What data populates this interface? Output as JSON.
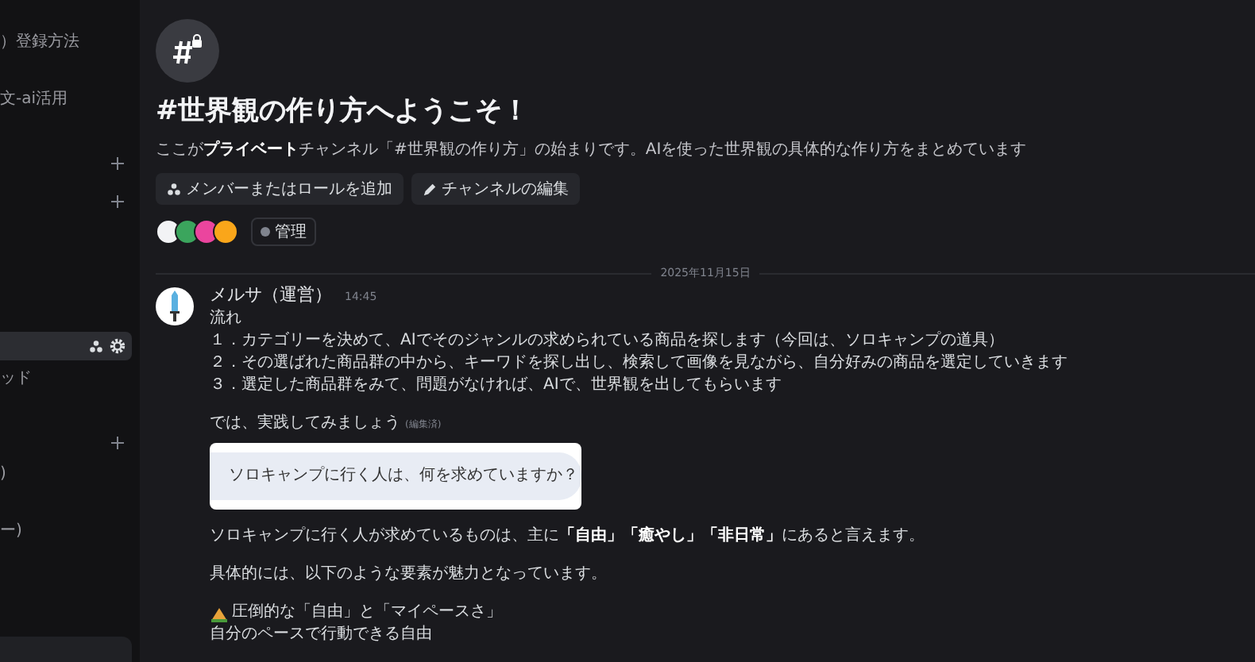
{
  "sidebar": {
    "items": [
      {
        "kind": "text",
        "label": "）登録方法",
        "selected": false
      },
      {
        "kind": "text",
        "label": "文-ai活用",
        "selected": false
      },
      {
        "kind": "add"
      },
      {
        "kind": "add"
      },
      {
        "kind": "channel",
        "selected": true
      },
      {
        "kind": "text",
        "label": "ッド",
        "selected": false
      },
      {
        "kind": "add"
      },
      {
        "kind": "text",
        "label": ")",
        "selected": false
      },
      {
        "kind": "text",
        "label": "ー)",
        "selected": false
      },
      {
        "kind": "panel"
      }
    ]
  },
  "welcome": {
    "title": "#世界観の作り方へようこそ！",
    "description": "ここが**プライベート**チャンネル「#世界観の作り方」の始まりです。AIを使った世界観の具体的な作り方をまとめています",
    "buttons": [
      {
        "kind": "members",
        "label": "メンバーまたはロールを追加"
      },
      {
        "kind": "edit",
        "label": "チャンネルの編集"
      }
    ],
    "members": [
      {
        "color": "#f2f3f5"
      },
      {
        "color": "#3ba55d"
      },
      {
        "color": "#eb459e"
      },
      {
        "color": "#faa61a"
      }
    ],
    "role": "管理"
  },
  "date_divider": "2025年11月15日",
  "message": {
    "author": "メルサ（運営）",
    "time": "14:45",
    "blocks": [
      {
        "kind": "lines",
        "lines": [
          "流れ",
          "１．カテゴリーを決めて、AIでそのジャンルの求められている商品を探します（今回は、ソロキャンプの道具）",
          "２．その選ばれた商品群の中から、キーワドを探し出し、検索して画像を見ながら、自分好みの商品を選定していきます",
          "３．選定した商品群をみて、問題がなければ、AIで、世界観を出してもらいます"
        ]
      },
      {
        "kind": "edited",
        "text": "では、実践してみましょう",
        "note": "(編集済)"
      },
      {
        "kind": "prompt",
        "text": "ソロキャンプに行く人は、何を求めていますか？"
      },
      {
        "kind": "lines",
        "lines": [
          "ソロキャンプに行く人が求めているものは、主に**「自由」「癒やし」「非日常」**にあると言えます。"
        ]
      },
      {
        "kind": "lines",
        "lines": [
          "具体的には、以下のような要素が魅力となっています。"
        ]
      },
      {
        "kind": "camp",
        "text": "圧倒的な「自由」と「マイペースさ」"
      },
      {
        "kind": "tight",
        "lines": [
          "自分のペースで行動できる自由"
        ]
      }
    ]
  }
}
